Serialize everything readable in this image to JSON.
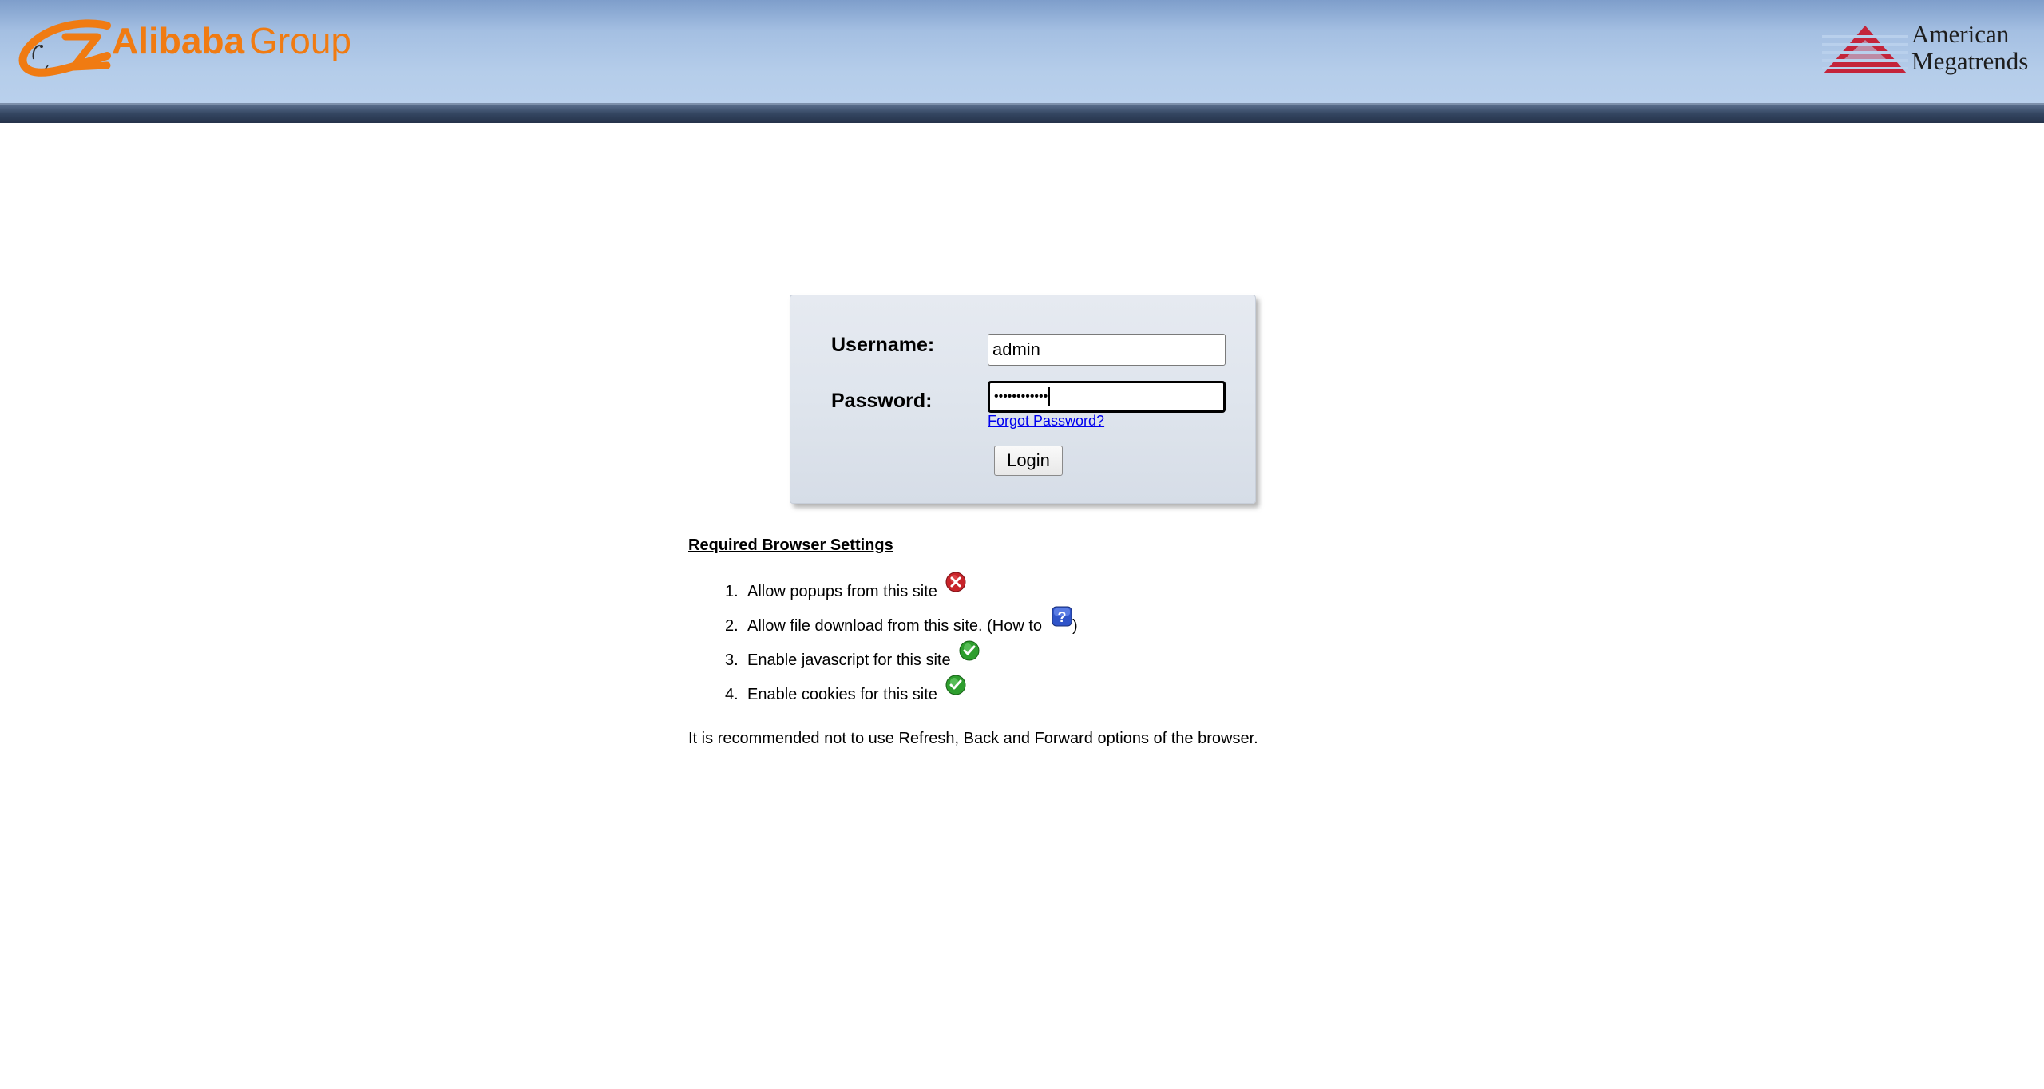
{
  "header": {
    "left_logo": {
      "brand": "Alibaba",
      "suffix": "Group",
      "icon": "alibaba-logo-icon",
      "color": "#f07b12"
    },
    "right_logo": {
      "line1": "American",
      "line2": "Megatrends",
      "icon": "ami-logo-icon",
      "color": "#c4243a"
    }
  },
  "login": {
    "username_label": "Username:",
    "username_value": "admin",
    "password_label": "Password:",
    "password_masked": "••••••••••••",
    "forgot_link": "Forgot Password?",
    "login_button": "Login"
  },
  "browser_settings": {
    "title": "Required Browser Settings",
    "items": [
      {
        "num": "1.",
        "text": "Allow popups from this site",
        "status_icon": "error-icon"
      },
      {
        "num": "2.",
        "text": "Allow file download from this site. (How to",
        "status_icon": "help-icon",
        "suffix": ")"
      },
      {
        "num": "3.",
        "text": "Enable javascript for this site",
        "status_icon": "check-icon"
      },
      {
        "num": "4.",
        "text": "Enable cookies for this site",
        "status_icon": "check-icon"
      }
    ],
    "note": "It is recommended not to use Refresh, Back and Forward options of the browser."
  }
}
